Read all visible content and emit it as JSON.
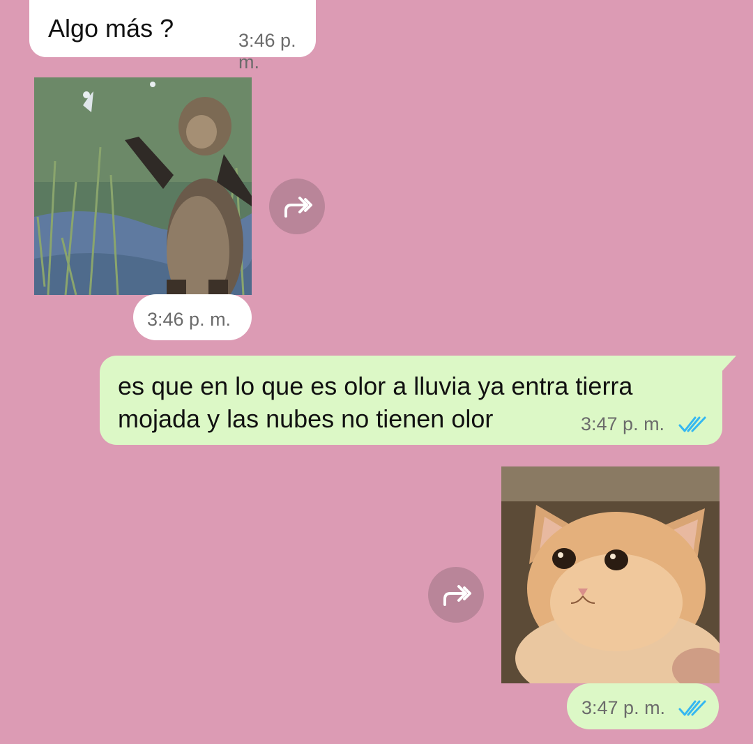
{
  "chat": {
    "messages": [
      {
        "type": "text",
        "direction": "incoming",
        "text": "Algo más ?",
        "time": "3:46 p. m."
      },
      {
        "type": "sticker",
        "direction": "incoming",
        "subject": "monkey",
        "time": "3:46 p. m.",
        "forward_icon": "forward-icon"
      },
      {
        "type": "text",
        "direction": "outgoing",
        "text": "es que en lo que es olor a lluvia ya entra tierra mojada y las nubes no tienen olor",
        "time": "3:47 p. m.",
        "status_icon": "double-check-icon"
      },
      {
        "type": "sticker",
        "direction": "outgoing",
        "subject": "cat",
        "time": "3:47 p. m.",
        "forward_icon": "forward-icon",
        "status_icon": "double-check-icon"
      }
    ]
  },
  "colors": {
    "wallpaper": "#dc9bb4",
    "incoming_bubble": "#ffffff",
    "outgoing_bubble": "#dcf8c6",
    "forward_button": "#b98599",
    "read_tick": "#34b7f1"
  }
}
